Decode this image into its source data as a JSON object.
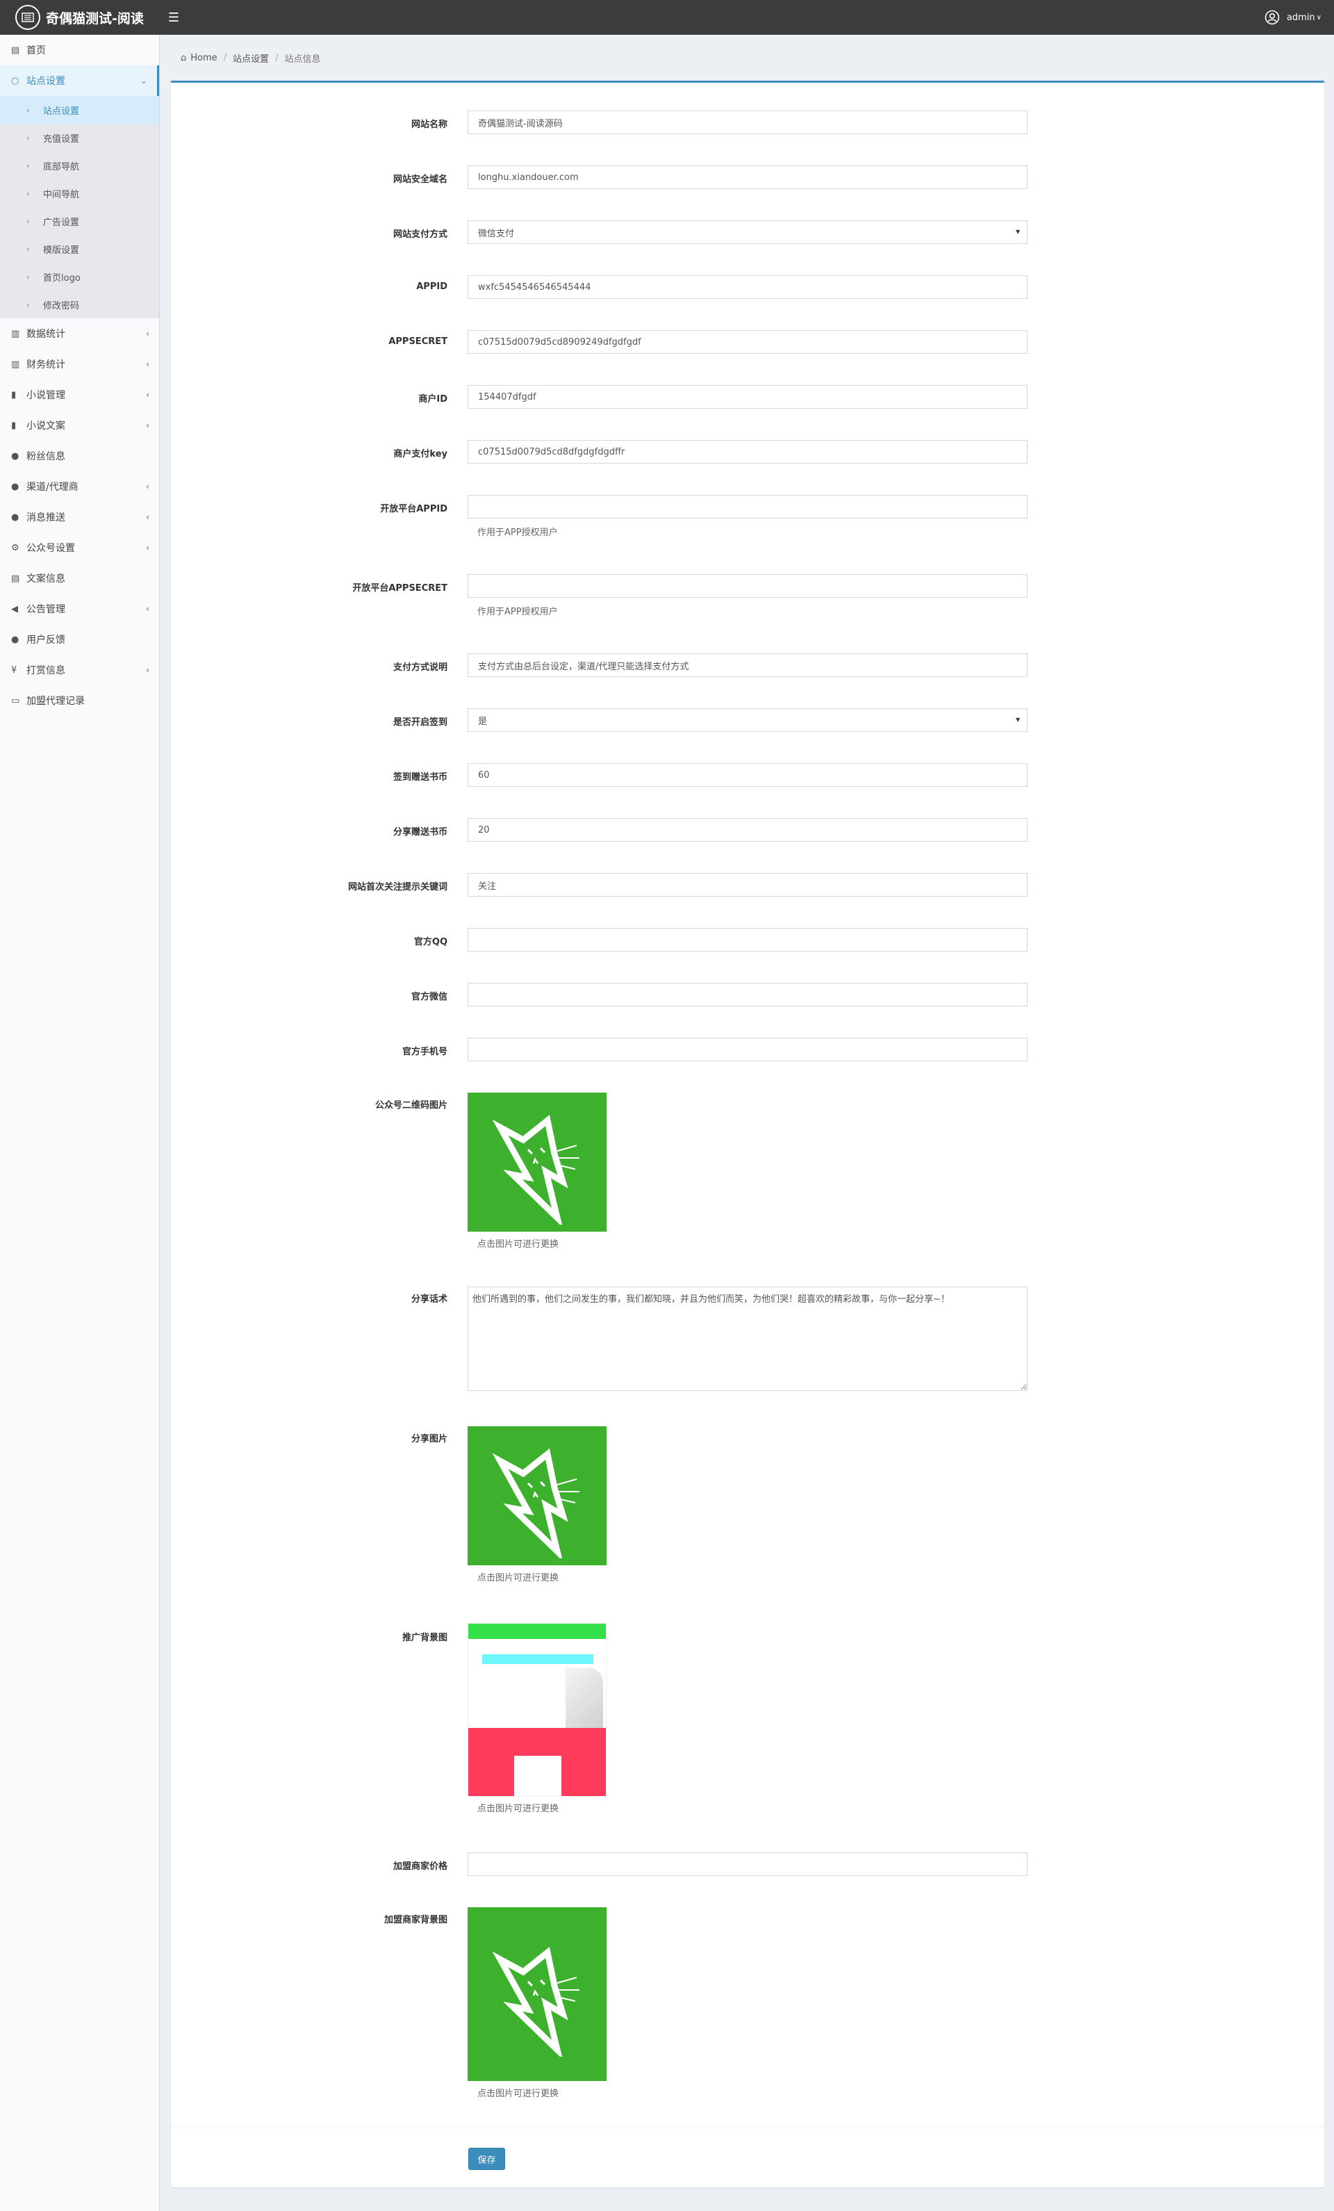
{
  "header": {
    "brand": "奇偶猫测试-阅读",
    "user": "admin"
  },
  "sidebar": {
    "items": [
      {
        "label": "首页",
        "icon": "dashboard-icon"
      },
      {
        "label": "站点设置",
        "icon": "circle-icon",
        "sub": [
          "站点设置",
          "充值设置",
          "底部导航",
          "中间导航",
          "广告设置",
          "模版设置",
          "首页logo",
          "修改密码"
        ]
      },
      {
        "label": "数据统计",
        "icon": "bar-chart-icon"
      },
      {
        "label": "财务统计",
        "icon": "bar-chart-icon"
      },
      {
        "label": "小说管理",
        "icon": "book-icon"
      },
      {
        "label": "小说文案",
        "icon": "book-icon"
      },
      {
        "label": "粉丝信息",
        "icon": "users-icon"
      },
      {
        "label": "渠道/代理商",
        "icon": "user-plus-icon"
      },
      {
        "label": "消息推送",
        "icon": "comment-icon"
      },
      {
        "label": "公众号设置",
        "icon": "cogs-icon"
      },
      {
        "label": "文案信息",
        "icon": "list-icon"
      },
      {
        "label": "公告管理",
        "icon": "bullhorn-icon"
      },
      {
        "label": "用户反馈",
        "icon": "comment-icon"
      },
      {
        "label": "打赏信息",
        "icon": "yen-icon"
      },
      {
        "label": "加盟代理记录",
        "icon": "id-card-icon"
      }
    ]
  },
  "breadcrumb": {
    "home": "Home",
    "level1": "站点设置",
    "level2": "站点信息"
  },
  "form": {
    "site_name": {
      "label": "网站名称",
      "value": "奇偶猫测试-阅读源码"
    },
    "site_domain": {
      "label": "网站安全域名",
      "value": "longhu.xiandouer.com"
    },
    "pay_method": {
      "label": "网站支付方式",
      "value": "微信支付"
    },
    "appid": {
      "label": "APPID",
      "value": "wxfc5454546546545444"
    },
    "appsecret": {
      "label": "APPSECRET",
      "value": "c07515d0079d5cd8909249dfgdfgdf"
    },
    "mch_id": {
      "label": "商户ID",
      "value": "154407dfgdf"
    },
    "mch_key": {
      "label": "商户支付key",
      "value": "c07515d0079d5cd8dfgdgfdgdffr"
    },
    "open_appid": {
      "label": "开放平台APPID",
      "value": "",
      "help": "作用于APP授权用户"
    },
    "open_appsecret": {
      "label": "开放平台APPSECRET",
      "value": "",
      "help": "作用于APP授权用户"
    },
    "pay_desc": {
      "label": "支付方式说明",
      "value": "支付方式由总后台设定，渠道/代理只能选择支付方式"
    },
    "sign_enable": {
      "label": "是否开启签到",
      "value": "是"
    },
    "sign_coins": {
      "label": "签到赠送书币",
      "value": "60"
    },
    "share_coins": {
      "label": "分享赠送书币",
      "value": "20"
    },
    "follow_keyword": {
      "label": "网站首次关注提示关键词",
      "value": "关注"
    },
    "qq": {
      "label": "官方QQ",
      "value": ""
    },
    "wechat": {
      "label": "官方微信",
      "value": ""
    },
    "phone": {
      "label": "官方手机号",
      "value": ""
    },
    "qrcode_img": {
      "label": "公众号二维码图片",
      "help": "点击图片可进行更换"
    },
    "share_text": {
      "label": "分享话术",
      "value": "他们所遇到的事，他们之间发生的事，我们都知晓，并且为他们而笑，为他们哭！超喜欢的精彩故事，与你一起分享~！"
    },
    "share_img": {
      "label": "分享图片",
      "help": "点击图片可进行更换"
    },
    "promo_img": {
      "label": "推广背景图",
      "help": "点击图片可进行更换"
    },
    "franchise_price": {
      "label": "加盟商家价格",
      "value": ""
    },
    "franchise_img": {
      "label": "加盟商家背景图",
      "help": "点击图片可进行更换"
    },
    "save": "保存"
  },
  "colors": {
    "header_bg": "#3c3c3c",
    "accent": "#3c8dbc",
    "image_green": "#3db12e",
    "promo_red": "#ff3b5c"
  }
}
